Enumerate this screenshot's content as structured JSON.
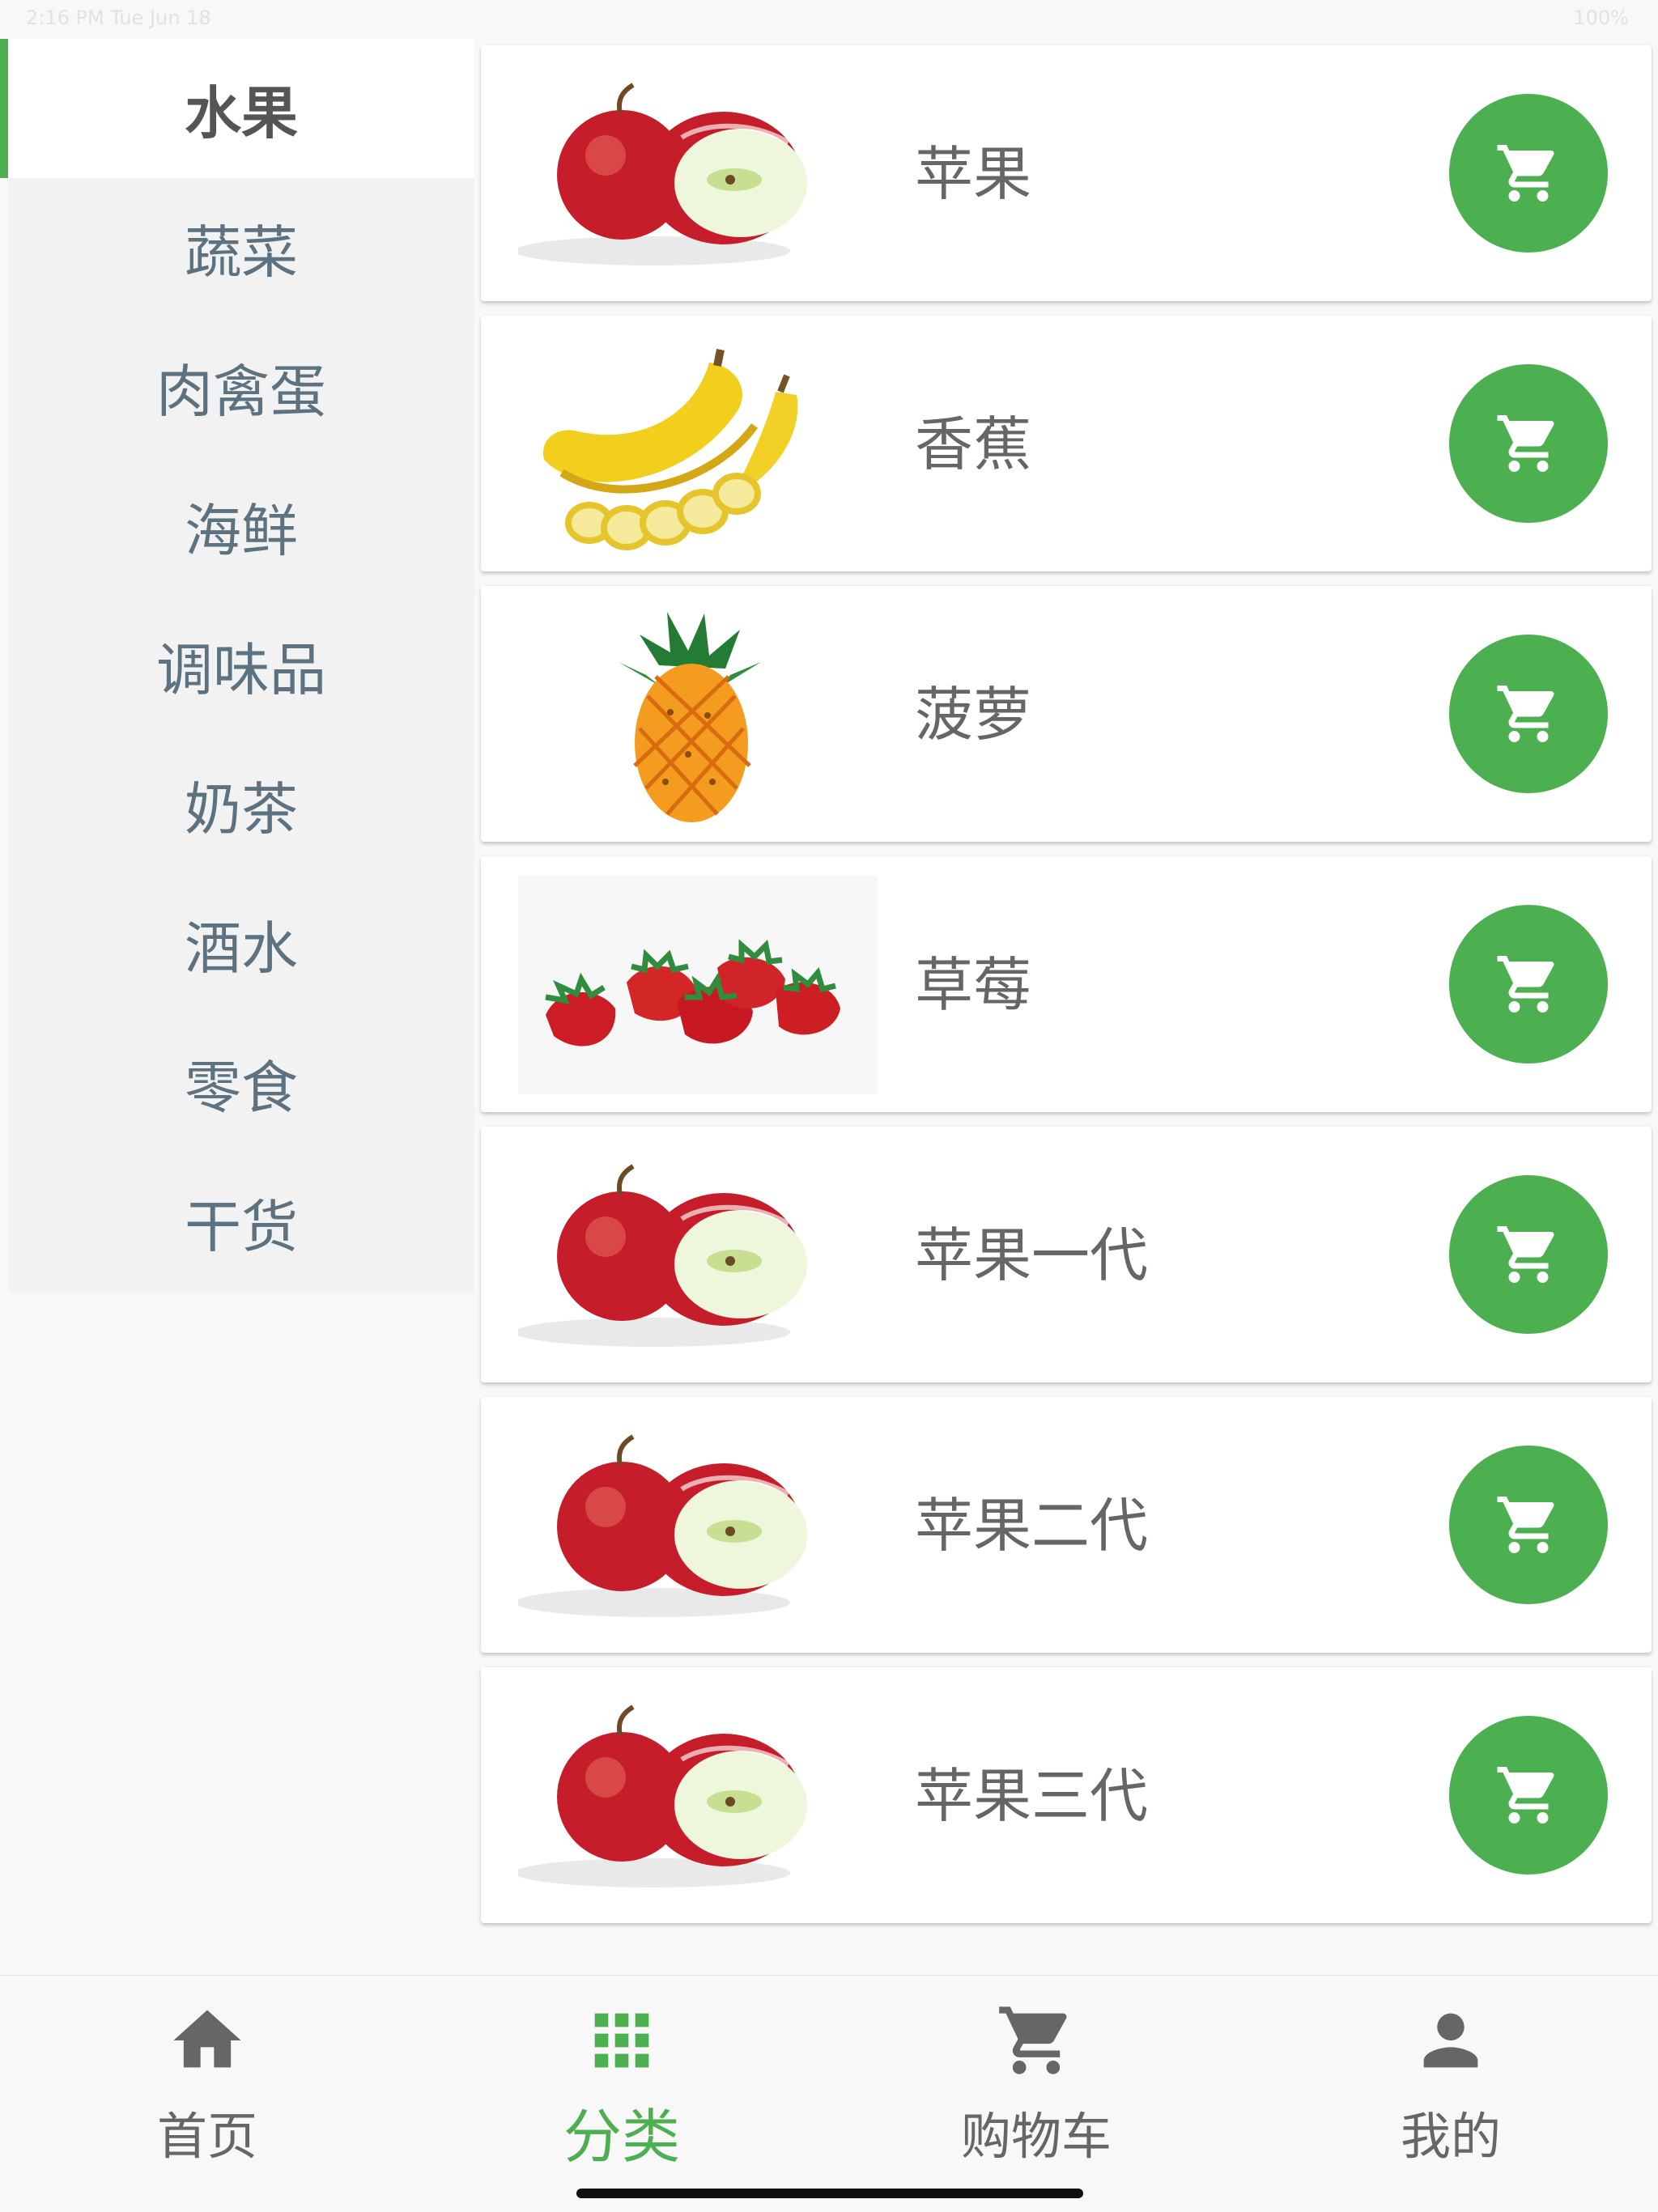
{
  "colors": {
    "accent": "#4caf50",
    "sidebar_background": "#f2f2f2",
    "sidebar_text": "#5d7280",
    "active_text": "#555555",
    "product_text": "#666666"
  },
  "status_bar": {
    "left": "2:16 PM  Tue Jun 18",
    "right": "100%"
  },
  "sidebar": {
    "items": [
      {
        "label": "水果",
        "active": true
      },
      {
        "label": "蔬菜"
      },
      {
        "label": "肉禽蛋"
      },
      {
        "label": "海鲜"
      },
      {
        "label": "调味品"
      },
      {
        "label": "奶茶"
      },
      {
        "label": "酒水"
      },
      {
        "label": "零食"
      },
      {
        "label": "干货"
      }
    ]
  },
  "products": [
    {
      "name": "苹果",
      "image": "apple-image",
      "button_icon": "cart-icon"
    },
    {
      "name": "香蕉",
      "image": "banana-image",
      "button_icon": "cart-icon"
    },
    {
      "name": "菠萝",
      "image": "pineapple-image",
      "button_icon": "cart-icon"
    },
    {
      "name": "草莓",
      "image": "strawberry-image",
      "button_icon": "cart-icon"
    },
    {
      "name": "苹果一代",
      "image": "apple-image",
      "button_icon": "cart-icon"
    },
    {
      "name": "苹果二代",
      "image": "apple-image",
      "button_icon": "cart-icon"
    },
    {
      "name": "苹果三代",
      "image": "apple-image",
      "button_icon": "cart-icon"
    }
  ],
  "bottom_nav": {
    "active": "分类",
    "items": [
      {
        "label": "首页",
        "icon": "home-icon"
      },
      {
        "label": "分类",
        "icon": "grid-icon"
      },
      {
        "label": "购物车",
        "icon": "cart-icon"
      },
      {
        "label": "我的",
        "icon": "user-icon"
      }
    ]
  }
}
